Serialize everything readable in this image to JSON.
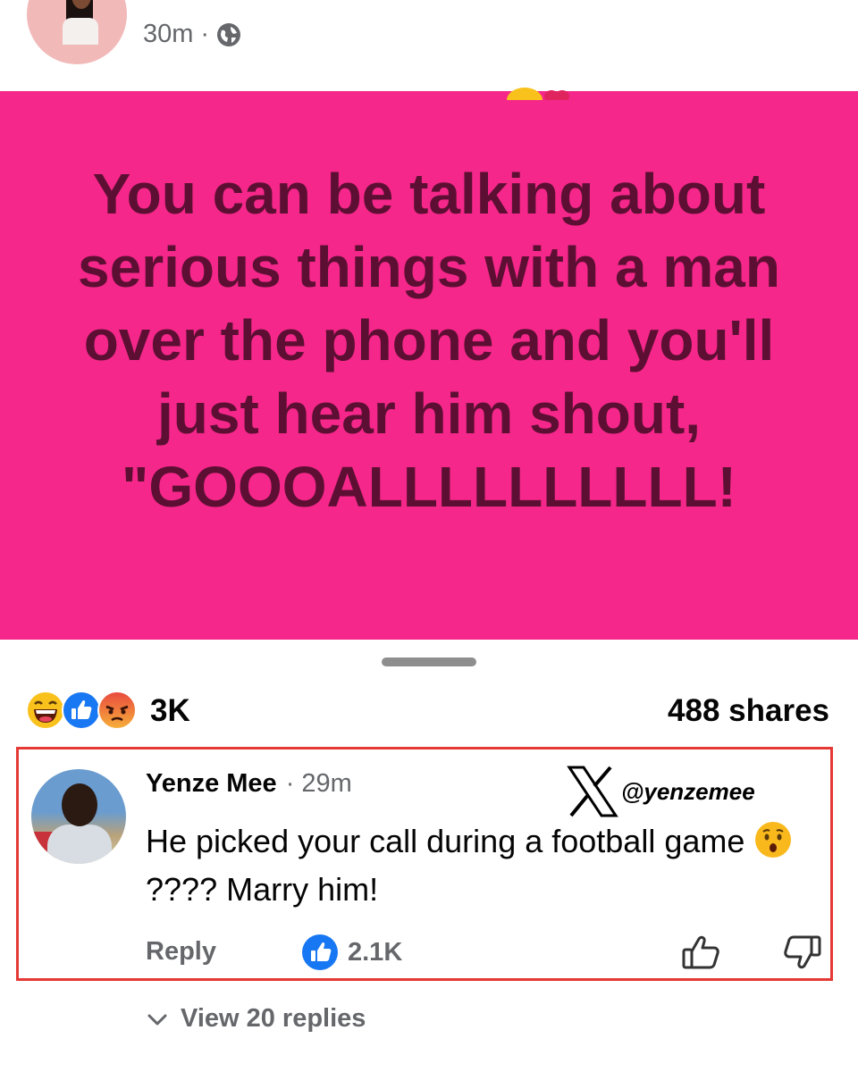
{
  "post": {
    "time": "30m",
    "separator": "·",
    "text": "You can be talking about serious things with a man over the phone and you'll just hear him shout, \"GOOOALLLLLLLLLL!",
    "card_color": "#f5278a",
    "text_color": "#5c0f33"
  },
  "reactions": {
    "icons": [
      "laughing-emoji-icon",
      "like-icon",
      "angry-emoji-icon"
    ],
    "count": "3K",
    "shares": "488 shares"
  },
  "comment": {
    "author": "Yenze Mee",
    "time": "· 29m",
    "watermark_handle": "@yenzemee",
    "text_before_emoji": "He picked your call during a football game ",
    "text_after_emoji": "???? Marry him!",
    "reply_label": "Reply",
    "like_count": "2.1K",
    "highlight_color": "#e53935"
  },
  "replies": {
    "label": "View 20 replies"
  }
}
